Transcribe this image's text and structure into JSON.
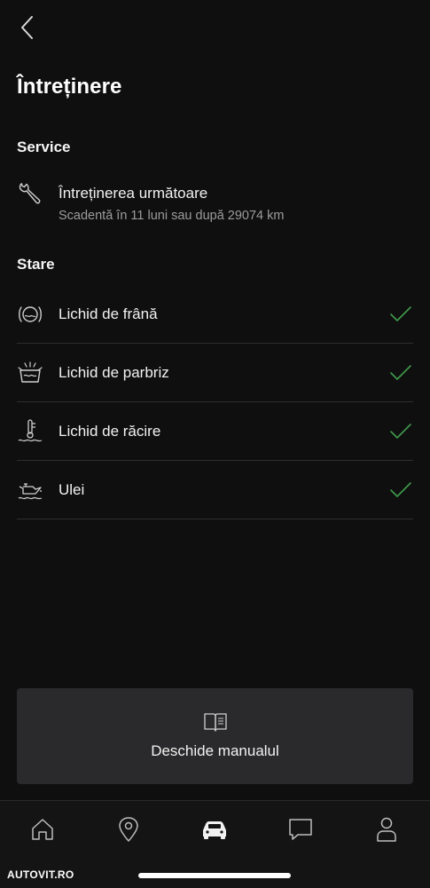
{
  "header": {
    "title": "Întreținere"
  },
  "service": {
    "section_label": "Service",
    "item_title": "Întreținerea următoare",
    "item_subtitle": "Scadentă în 11 luni sau după 29074 km",
    "icon": "wrench-icon"
  },
  "status": {
    "section_label": "Stare",
    "items": [
      {
        "label": "Lichid de frână",
        "icon": "brake-fluid-icon",
        "ok": true
      },
      {
        "label": "Lichid de parbriz",
        "icon": "washer-fluid-icon",
        "ok": true
      },
      {
        "label": "Lichid de răcire",
        "icon": "coolant-icon",
        "ok": true
      },
      {
        "label": "Ulei",
        "icon": "oil-can-icon",
        "ok": true
      }
    ]
  },
  "manual": {
    "label": "Deschide manualul",
    "icon": "book-icon"
  },
  "tabbar": {
    "items": [
      {
        "name": "home",
        "icon": "home-icon"
      },
      {
        "name": "location",
        "icon": "location-pin-icon"
      },
      {
        "name": "car",
        "icon": "car-icon",
        "active": true
      },
      {
        "name": "messages",
        "icon": "chat-icon"
      },
      {
        "name": "profile",
        "icon": "profile-icon"
      }
    ]
  },
  "watermark": "AUTOVIT.RO",
  "colors": {
    "background": "#0f0f10",
    "check_green": "#3f9a4a",
    "card": "#2a2a2c",
    "divider": "#2e2e30",
    "muted_text": "#9c9c9c"
  }
}
